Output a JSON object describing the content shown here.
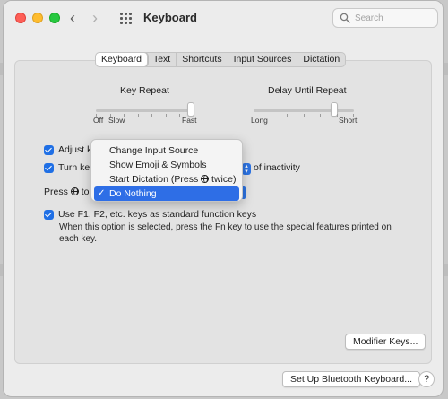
{
  "window": {
    "title": "Keyboard"
  },
  "search": {
    "placeholder": "Search"
  },
  "tabs": [
    {
      "label": "Keyboard",
      "active": true
    },
    {
      "label": "Text"
    },
    {
      "label": "Shortcuts"
    },
    {
      "label": "Input Sources"
    },
    {
      "label": "Dictation"
    }
  ],
  "key_repeat": {
    "label": "Key Repeat",
    "min_label": "Off",
    "min2_label": "Slow",
    "max_label": "Fast",
    "value": 1.0
  },
  "delay_until_repeat": {
    "label": "Delay Until Repeat",
    "min_label": "Long",
    "max_label": "Short",
    "value": 0.83
  },
  "options": {
    "adjust_label": "Adjust k",
    "turn_label": "Turn ke",
    "inactivity_label": "of inactivity",
    "press_label": "Press",
    "press_suffix": "to",
    "fn_keys_label": "Use F1, F2, etc. keys as standard function keys",
    "fn_keys_desc_line1": "When this option is selected, press the Fn key to use the special features printed on",
    "fn_keys_desc_line2": "each key."
  },
  "menu": {
    "items": [
      {
        "label": "Change Input Source"
      },
      {
        "label": "Show Emoji & Symbols"
      },
      {
        "label": "Start Dictation (Press",
        "label_suffix": "twice)"
      },
      {
        "label": "Do Nothing",
        "selected": true,
        "checkmark": "✓"
      }
    ]
  },
  "buttons": {
    "modifier_keys": "Modifier Keys...",
    "bluetooth": "Set Up Bluetooth Keyboard...",
    "help": "?"
  },
  "colors": {
    "accent": "#2e6ee6",
    "checkbox": "#1f6fe5"
  }
}
